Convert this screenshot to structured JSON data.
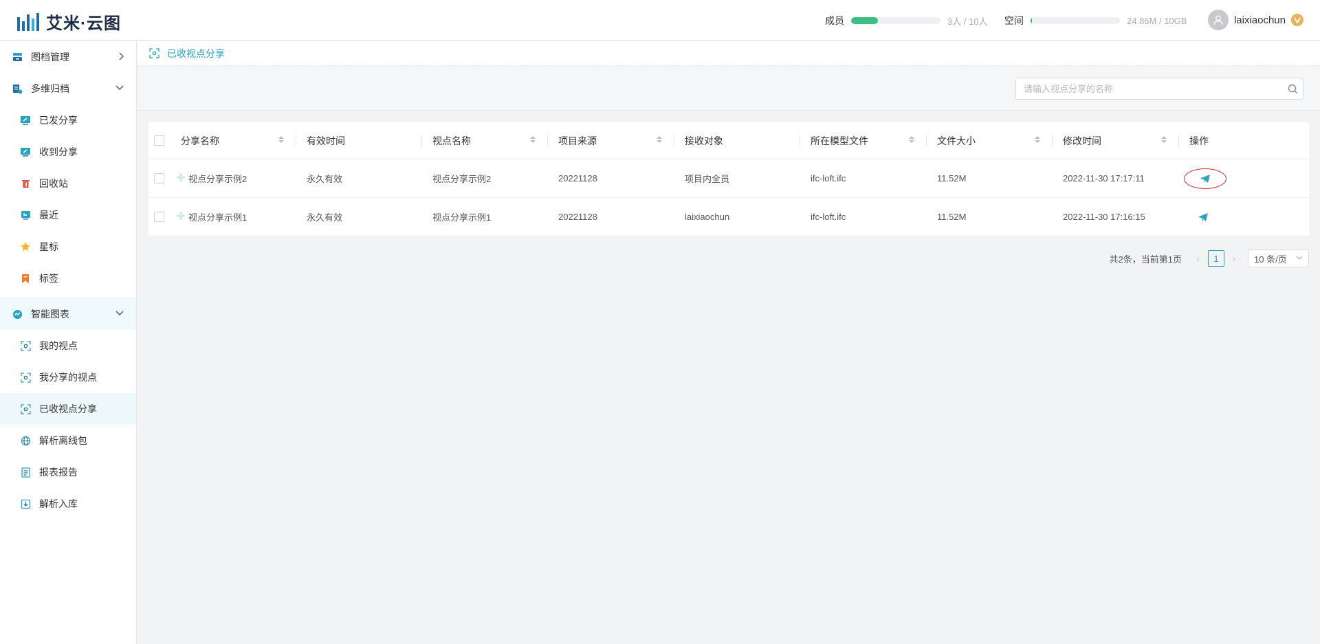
{
  "app": {
    "title": "艾米·云图"
  },
  "header": {
    "members": {
      "label": "成员",
      "value": "3人 / 10人",
      "progress": 0.3,
      "color": "#3cc082"
    },
    "space": {
      "label": "空间",
      "value": "24.86M / 10GB",
      "progress": 0.003,
      "color": "#2aa2c0"
    },
    "user": {
      "name": "laixiaochun"
    }
  },
  "sidebar": {
    "groups": [
      {
        "label": "图档管理",
        "icon": "archive-icon",
        "expanded": false
      },
      {
        "label": "多维归档",
        "icon": "multi-archive-icon",
        "expanded": true,
        "items": [
          {
            "label": "已发分享",
            "icon": "sent-share-icon"
          },
          {
            "label": "收到分享",
            "icon": "received-share-icon"
          },
          {
            "label": "回收站",
            "icon": "trash-icon"
          },
          {
            "label": "最近",
            "icon": "recent-icon"
          },
          {
            "label": "星标",
            "icon": "star-icon"
          },
          {
            "label": "标签",
            "icon": "tag-icon"
          }
        ]
      },
      {
        "label": "智能图表",
        "icon": "smart-chart-icon",
        "expanded": true,
        "items": [
          {
            "label": "我的视点",
            "icon": "viewpoint-icon"
          },
          {
            "label": "我分享的视点",
            "icon": "viewpoint-icon"
          },
          {
            "label": "已收视点分享",
            "icon": "viewpoint-icon",
            "active": true
          },
          {
            "label": "解析离线包",
            "icon": "globe-icon"
          },
          {
            "label": "报表报告",
            "icon": "report-icon"
          },
          {
            "label": "解析入库",
            "icon": "import-icon"
          }
        ]
      }
    ]
  },
  "breadcrumb": {
    "label": "已收视点分享"
  },
  "search": {
    "placeholder": "请输入视点分享的名称"
  },
  "table": {
    "columns": [
      "分享名称",
      "有效时间",
      "视点名称",
      "项目来源",
      "接收对象",
      "所在模型文件",
      "文件大小",
      "修改时间",
      "操作"
    ],
    "rows": [
      {
        "share_name": "视点分享示例2",
        "valid": "永久有效",
        "viewpoint": "视点分享示例2",
        "project": "20221128",
        "receiver": "项目内全员",
        "model_file": "ifc-loft.ifc",
        "size": "11.52M",
        "modified": "2022-11-30 17:17:11"
      },
      {
        "share_name": "视点分享示例1",
        "valid": "永久有效",
        "viewpoint": "视点分享示例1",
        "project": "20221128",
        "receiver": "laixiaochun",
        "model_file": "ifc-loft.ifc",
        "size": "11.52M",
        "modified": "2022-11-30 17:16:15"
      }
    ]
  },
  "pagination": {
    "summary": "共2条，当前第1页",
    "current": "1",
    "page_size": "10 条/页"
  },
  "colors": {
    "accent": "#2aa2c0",
    "brand": "#1d6ea8",
    "annotation": "#d92c2c"
  }
}
